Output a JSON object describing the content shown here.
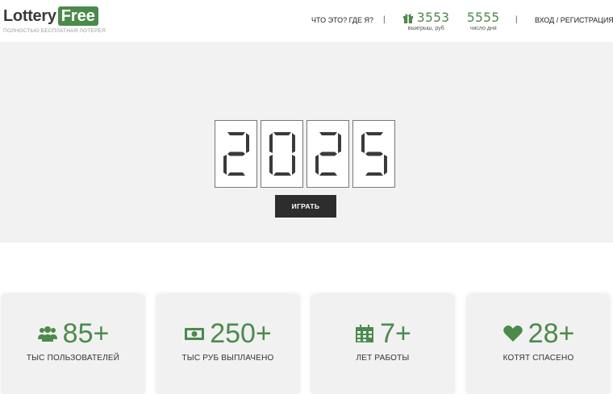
{
  "header": {
    "logo_text": "Lottery",
    "logo_box": "Free",
    "tagline": "ПОЛНОСТЬЮ БЕСПЛАТНАЯ ЛОТЕРЕЯ",
    "nav_about": "ЧТО ЭТО? ГДЕ Я?",
    "separator": "|",
    "winnings": {
      "value": "3553",
      "label": "выигрыш, руб"
    },
    "day_number": {
      "value": "5555",
      "label": "число дня"
    },
    "login": "ВХОД / РЕГИСТРАЦИЯ"
  },
  "hero": {
    "digits": [
      "2",
      "0",
      "2",
      "5"
    ],
    "play_label": "ИГРАТЬ"
  },
  "stats": [
    {
      "value": "85+",
      "label": "ТЫС ПОЛЬЗОВАТЕЛЕЙ",
      "icon": "users-icon"
    },
    {
      "value": "250+",
      "label": "ТЫС РУБ ВЫПЛАЧЕНО",
      "icon": "money-icon"
    },
    {
      "value": "7+",
      "label": "ЛЕТ РАБОТЫ",
      "icon": "calendar-icon"
    },
    {
      "value": "28+",
      "label": "КОТЯТ СПАСЕНО",
      "icon": "heart-icon"
    }
  ],
  "colors": {
    "accent": "#4c8a4c",
    "button": "#2d2d2d",
    "hero_bg": "#f2f2f2"
  }
}
